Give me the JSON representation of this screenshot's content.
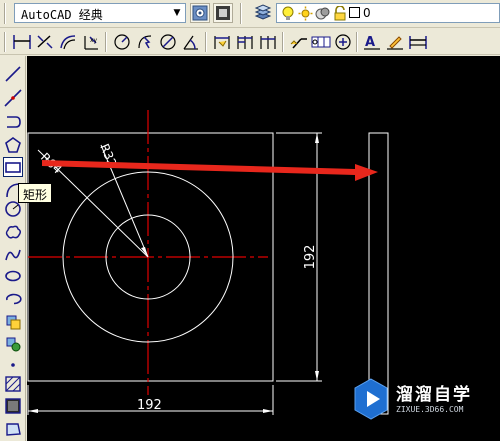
{
  "workspace": {
    "value": "AutoCAD 经典"
  },
  "layer": {
    "current": "0"
  },
  "tooltip": {
    "text": "矩形"
  },
  "drawing": {
    "dim_horizontal": "192",
    "dim_vertical": "192",
    "radius_outer": "R64",
    "radius_inner": "R32"
  },
  "watermark": {
    "title": "溜溜自学",
    "subtitle": "ZIXUE.3D66.COM"
  },
  "colors": {
    "annotation_arrow": "#e8271c",
    "center_line": "#e00000",
    "geometry": "#ffffff",
    "canvas": "#000000"
  },
  "icons": {
    "top_row": [
      "workspace-settings-icon",
      "workspace-toggle-icon",
      "layer-manager-icon",
      "lightbulb-icon",
      "sun-icon",
      "color-ring-icon",
      "lock-icon",
      "color-square-icon"
    ],
    "dimension_toolbar": [
      "linear-dimension-icon",
      "aligned-dimension-icon",
      "arc-length-icon",
      "ordinate-dimension-icon",
      "radius-dimension-icon",
      "jogged-dimension-icon",
      "diameter-dimension-icon",
      "angular-dimension-icon",
      "quick-dimension-icon",
      "baseline-dimension-icon",
      "continue-dimension-icon",
      "quick-leader-icon",
      "tolerance-icon",
      "center-mark-icon",
      "dimension-edit-icon",
      "dimension-text-edit-icon",
      "dimension-update-icon"
    ],
    "draw_toolbar": [
      "line-icon",
      "construction-line-icon",
      "polyline-icon",
      "polygon-icon",
      "rectangle-icon",
      "arc-icon",
      "circle-icon",
      "revision-cloud-icon",
      "spline-icon",
      "ellipse-icon",
      "ellipse-arc-icon",
      "insert-block-icon",
      "make-block-icon",
      "point-icon",
      "hatch-icon",
      "gradient-icon",
      "region-icon"
    ]
  }
}
